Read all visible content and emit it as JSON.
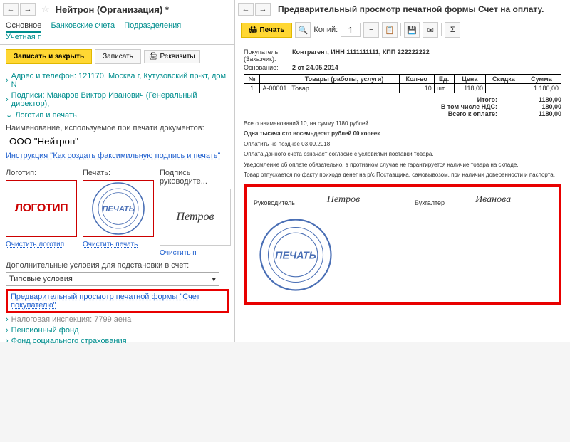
{
  "left": {
    "title": "Нейтрон (Организация) *",
    "tabs": {
      "t1": "Основное",
      "t2": "Банковские счета",
      "t3": "Подразделения",
      "t4": "Учетная п"
    },
    "btn_save_close": "Записать и закрыть",
    "btn_save": "Записать",
    "btn_req": "Реквизиты",
    "links": {
      "address": "Адрес и телефон: 121170, Москва г, Кутузовский пр-кт, дом N",
      "signs": "Подписи: Макаров Виктор Иванович (Генеральный директор),",
      "logo": "Логотип и печать"
    },
    "name_label": "Наименование, используемое при печати документов:",
    "name_value": "ООО \"Нейтрон\"",
    "instr_link": "Инструкция \"Как создать факсимильную подпись и печать\"",
    "col": {
      "logo": "Логотип:",
      "stamp": "Печать:",
      "sign": "Подпись руководите..."
    },
    "logo_text": "ЛОГОТИП",
    "stamp_text": "ПЕЧАТЬ",
    "sign_name": "Петров",
    "clear": {
      "logo": "Очистить логотип",
      "stamp": "Очистить печать",
      "sign": "Очистить п"
    },
    "extra_label": "Дополнительные условия для подстановки в счет:",
    "extra_value": "Типовые условия",
    "preview_link": "Предварительный просмотр печатной формы \"Счет покупателю\"",
    "tax": "Налоговая инспекция: 7799 аена",
    "pension": "Пенсионный фонд",
    "social": "Фонд социального страхования"
  },
  "right": {
    "title": "Предварительный просмотр печатной формы Счет на оплату.",
    "btn_print": "Печать",
    "copies_label": "Копий:",
    "copies": "1",
    "buyer_k": "Покупатель (Заказчик):",
    "buyer_v": "Контрагент, ИНН 1111111111, КПП 222222222",
    "basis_k": "Основание:",
    "basis_v": "2 от 24.05.2014",
    "table": {
      "headers": {
        "num": "№",
        "code": "",
        "goods": "Товары (работы, услуги)",
        "qty": "Кол-во",
        "unit": "Ед.",
        "price": "Цена",
        "disc": "Скидка",
        "sum": "Сумма"
      },
      "row": {
        "num": "1",
        "code": "А-00001",
        "goods": "Товар",
        "qty": "10",
        "unit": "шт",
        "price": "118,00",
        "disc": "",
        "sum": "1 180,00"
      }
    },
    "totals": {
      "itogo": "Итого:",
      "itogo_v": "1180,00",
      "nds": "В том числе НДС:",
      "nds_v": "180,00",
      "pay": "Всего к оплате:",
      "pay_v": "1180,00"
    },
    "count_text": "Всего наименований 10, на сумму 1180 рублей",
    "words": "Одна тысяча сто восемьдесят рублей 00 копеек",
    "due": "Оплатить не позднее 03.09.2018",
    "fine1": "Оплата данного счета означает согласие с условиями поставки товара.",
    "fine2": "Уведомление об оплате обязательно, в противном случае не гарантируется наличие товара на складе.",
    "fine3": "Товар отпускается по факту прихода денег на р/с Поставщика, самовывозом, при наличии доверенности и паспорта.",
    "sig": {
      "head": "Руководитель",
      "head_name": "Петров",
      "acc": "Бухгалтер",
      "acc_name": "Иванова"
    },
    "stamp_text": "ПЕЧАТЬ"
  }
}
